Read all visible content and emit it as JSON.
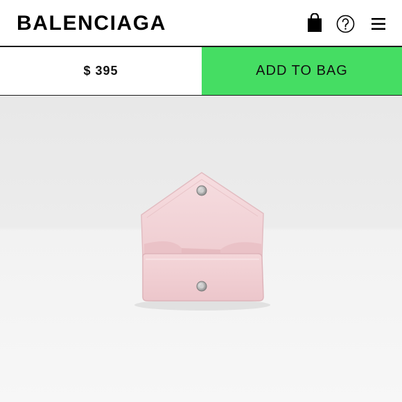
{
  "header": {
    "brand": "BALENCIAGA",
    "icons": [
      "shopping-bag-icon",
      "help-icon",
      "menu-icon"
    ]
  },
  "purchase": {
    "price": "$ 395",
    "add_to_bag_label": "ADD TO BAG"
  },
  "colors": {
    "accent": "#45dd63",
    "text": "#111111",
    "product": "#f3d5d8"
  }
}
